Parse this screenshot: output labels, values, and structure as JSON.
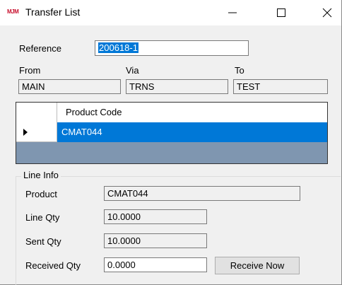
{
  "window": {
    "logo_text": "MJM",
    "title": "Transfer List",
    "minimize_glyph": "—",
    "maximize_glyph": "☐",
    "close_glyph": "✕"
  },
  "reference": {
    "label": "Reference",
    "value": "200618-1"
  },
  "route": {
    "from_label": "From",
    "from_value": "MAIN",
    "via_label": "Via",
    "via_value": "TRNS",
    "to_label": "To",
    "to_value": "TEST"
  },
  "grid": {
    "column_header": "Product Code",
    "rows": [
      "CMAT044"
    ]
  },
  "line_info": {
    "title": "Line Info",
    "product_label": "Product",
    "product_value": "CMAT044",
    "line_qty_label": "Line Qty",
    "line_qty_value": "10.0000",
    "sent_qty_label": "Sent Qty",
    "sent_qty_value": "10.0000",
    "received_qty_label": "Received Qty",
    "received_qty_value": "0.0000",
    "receive_button": "Receive Now"
  },
  "colors": {
    "selection": "#0078d7",
    "grid_empty": "#7f96b0",
    "logo": "#c8102e"
  }
}
